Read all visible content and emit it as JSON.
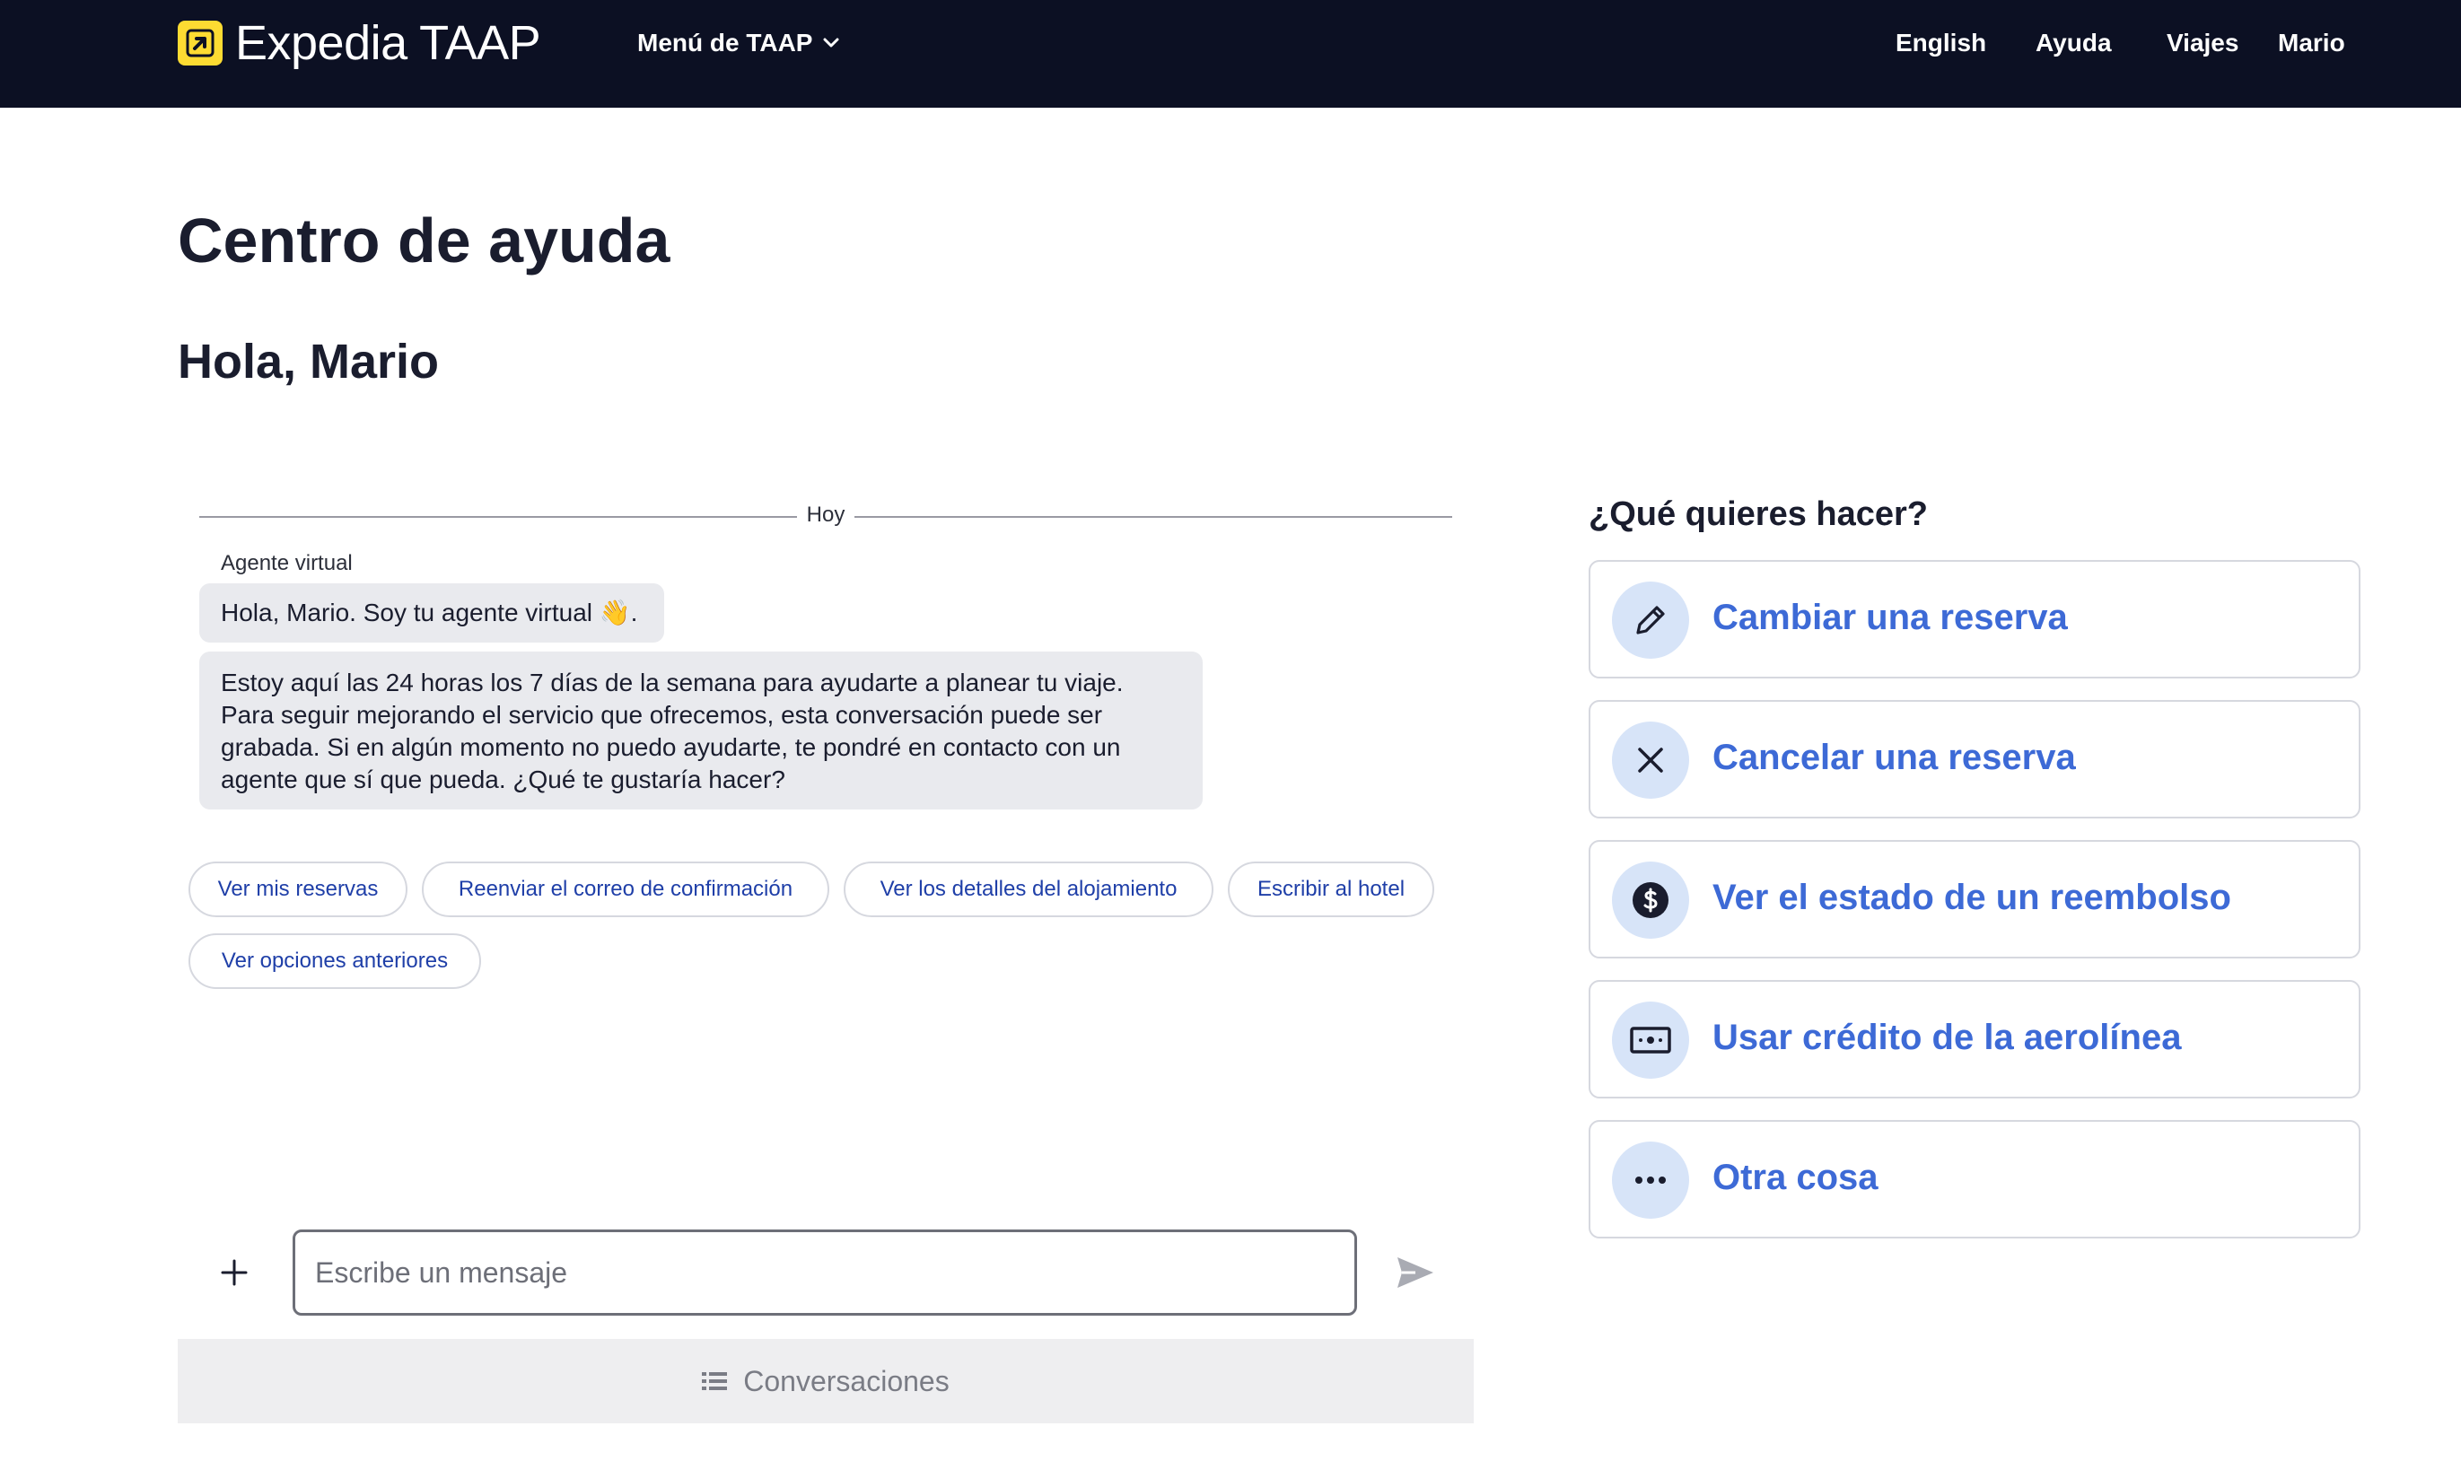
{
  "header": {
    "logo_text": "Expedia TAAP",
    "taap_menu_label": "Menú de TAAP",
    "nav": {
      "language": "English",
      "help": "Ayuda",
      "trips": "Viajes",
      "user": "Mario"
    }
  },
  "page": {
    "title": "Centro de ayuda",
    "greeting": "Hola, Mario"
  },
  "chat": {
    "date_divider": "Hoy",
    "sender": "Agente virtual",
    "messages": [
      "Hola, Mario. Soy tu agente virtual 👋.",
      "Estoy aquí las 24 horas los 7 días de la semana para ayudarte a planear tu viaje. Para seguir mejorando el servicio que ofrecemos, esta conversación puede ser grabada. Si en algún momento no puedo ayudarte, te pondré en contacto con un agente que sí que pueda. ¿Qué te gustaría hacer?"
    ],
    "quick_replies": [
      "Ver mis reservas",
      "Reenviar el correo de confirmación",
      "Ver los detalles del alojamiento",
      "Escribir al hotel",
      "Ver opciones anteriores"
    ],
    "input_placeholder": "Escribe un mensaje",
    "conversations_label": "Conversaciones"
  },
  "actions": {
    "title": "¿Qué quieres hacer?",
    "items": [
      {
        "label": "Cambiar una reserva",
        "icon": "pencil-icon"
      },
      {
        "label": "Cancelar una reserva",
        "icon": "close-icon"
      },
      {
        "label": "Ver el estado de un reembolso",
        "icon": "dollar-icon"
      },
      {
        "label": "Usar crédito de la aerolínea",
        "icon": "credit-icon"
      },
      {
        "label": "Otra cosa",
        "icon": "more-icon"
      }
    ]
  },
  "colors": {
    "header_bg": "#0c1023",
    "brand_yellow": "#fddb32",
    "link_blue": "#3d6ad6",
    "chip_text": "#1f3fa8",
    "icon_circle": "#d7e4f8",
    "bubble_bg": "#e9eaee"
  }
}
